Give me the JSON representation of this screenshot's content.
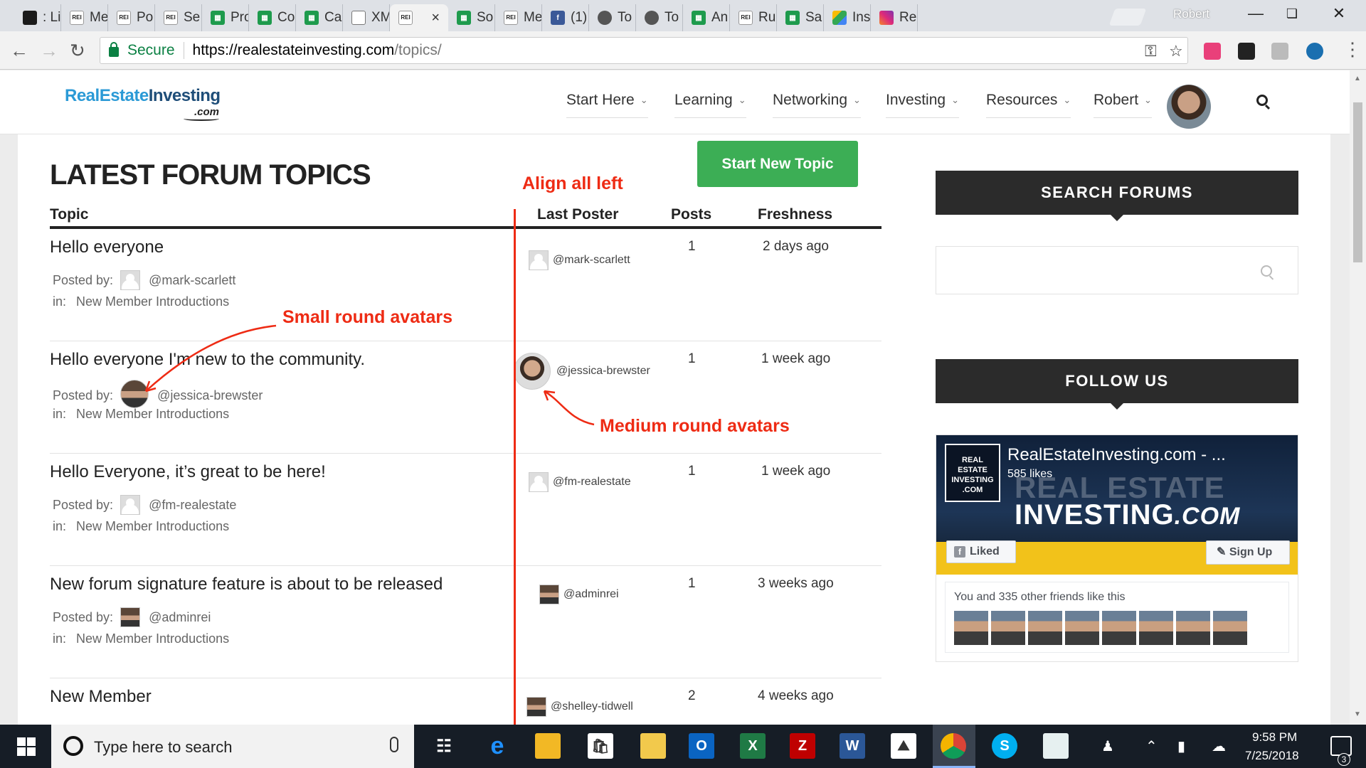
{
  "browser": {
    "tabs": [
      {
        "label": ": Li",
        "icon": "li"
      },
      {
        "label": "Me",
        "icon": "rei"
      },
      {
        "label": "Po",
        "icon": "rei"
      },
      {
        "label": "Se",
        "icon": "rei"
      },
      {
        "label": "Pro",
        "icon": "sheet"
      },
      {
        "label": "Co",
        "icon": "sheet"
      },
      {
        "label": "Cal",
        "icon": "sheet"
      },
      {
        "label": "XM",
        "icon": "doc"
      },
      {
        "label": "",
        "icon": "rei",
        "active": true
      },
      {
        "label": "So",
        "icon": "sheet"
      },
      {
        "label": "Me",
        "icon": "rei"
      },
      {
        "label": "(1)",
        "icon": "fb"
      },
      {
        "label": "To",
        "icon": "wp"
      },
      {
        "label": "To",
        "icon": "wp"
      },
      {
        "label": "An",
        "icon": "sheet"
      },
      {
        "label": "Ru",
        "icon": "rei"
      },
      {
        "label": "Sa",
        "icon": "sheet"
      },
      {
        "label": "Ins",
        "icon": "drive"
      },
      {
        "label": "Re",
        "icon": "ig"
      }
    ],
    "profile_name": "Robert",
    "secure_label": "Secure",
    "url_host": "https://realestateinvesting.com",
    "url_path": "/topics/"
  },
  "site": {
    "logo_main": "RealEstate",
    "logo_bold": "Investing",
    "logo_com": ".com",
    "menu": [
      "Start Here",
      "Learning",
      "Networking",
      "Investing",
      "Resources",
      "Robert"
    ]
  },
  "forum": {
    "title": "LATEST FORUM TOPICS",
    "new_topic_button": "Start New Topic",
    "columns": {
      "topic": "Topic",
      "last_poster": "Last Poster",
      "posts": "Posts",
      "freshness": "Freshness"
    },
    "posted_by_label": "Posted by:",
    "in_label": "in:",
    "topics": [
      {
        "title": "Hello everyone",
        "author": "@mark-scarlett",
        "forum": "New Member Introductions",
        "last_poster": "@mark-scarlett",
        "posts": "1",
        "freshness": "2 days ago"
      },
      {
        "title": "Hello everyone I'm new to the community.",
        "author": "@jessica-brewster",
        "forum": "New Member Introductions",
        "last_poster": "@jessica-brewster",
        "posts": "1",
        "freshness": "1 week ago"
      },
      {
        "title": "Hello Everyone, it’s great to be here!",
        "author": "@fm-realestate",
        "forum": "New Member Introductions",
        "last_poster": "@fm-realestate",
        "posts": "1",
        "freshness": "1 week ago"
      },
      {
        "title": "New forum signature feature is about to be released",
        "author": "@adminrei",
        "forum": "New Member Introductions",
        "last_poster": "@adminrei",
        "posts": "1",
        "freshness": "3 weeks ago"
      },
      {
        "title": "New Member",
        "author": "",
        "forum": "",
        "last_poster": "@shelley-tidwell",
        "posts": "2",
        "freshness": "4 weeks ago"
      }
    ]
  },
  "annotations": {
    "align": "Align all left",
    "small": "Small round avatars",
    "medium": "Medium round avatars"
  },
  "sidebar": {
    "search_heading": "SEARCH FORUMS",
    "follow_heading": "FOLLOW US",
    "fb_page_name": "RealEstateInvesting.com - ...",
    "fb_likes": "585 likes",
    "fb_cover_line1": "REAL ESTATE",
    "fb_cover_line2": "INVESTING",
    "fb_cover_com": ".COM",
    "fb_logo_text": "REAL ESTATE INVESTING .COM",
    "fb_liked": "Liked",
    "fb_signup": "Sign Up",
    "fb_friends": "You and 335 other friends like this"
  },
  "taskbar": {
    "search_placeholder": "Type here to search",
    "time": "9:58 PM",
    "date": "7/25/2018",
    "notifications": "3"
  },
  "colors": {
    "accent_green": "#3cae55",
    "annotation_red": "#ee2b14",
    "brand_blue": "#2b9ad6"
  }
}
